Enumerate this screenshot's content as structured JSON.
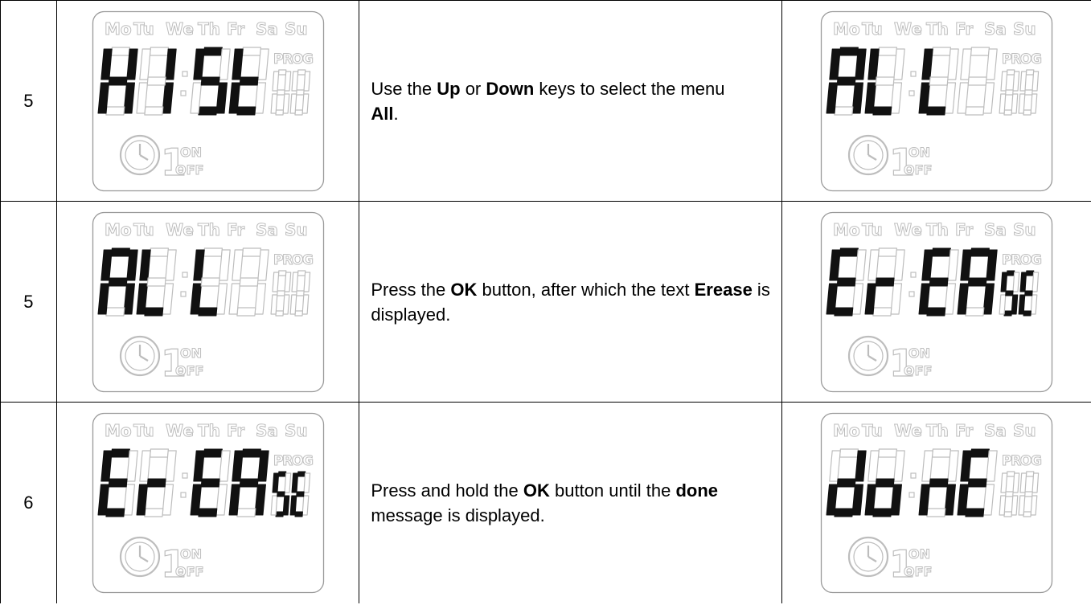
{
  "rows": [
    {
      "step": "5",
      "before": {
        "main": [
          "H",
          "I",
          "5",
          "t"
        ],
        "small": [
          "",
          ""
        ]
      },
      "text": [
        {
          "t": "Use the ",
          "b": false
        },
        {
          "t": "Up",
          "b": true
        },
        {
          "t": " or ",
          "b": false
        },
        {
          "t": "Down",
          "b": true
        },
        {
          "t": " keys to select the menu",
          "b": false
        },
        {
          "t": "\n",
          "b": false
        },
        {
          "t": "All",
          "b": true
        },
        {
          "t": ".",
          "b": false
        }
      ],
      "after": {
        "main": [
          "A",
          "L",
          "L",
          ""
        ],
        "small": [
          "",
          ""
        ]
      }
    },
    {
      "step": "5",
      "before": {
        "main": [
          "A",
          "L",
          "L",
          ""
        ],
        "small": [
          "",
          ""
        ]
      },
      "text": [
        {
          "t": "Press the ",
          "b": false
        },
        {
          "t": "OK",
          "b": true
        },
        {
          "t": " button, after which the text ",
          "b": false
        },
        {
          "t": "Erease",
          "b": true
        },
        {
          "t": " is displayed.",
          "b": false
        }
      ],
      "after": {
        "main": [
          "E",
          "r",
          "E",
          "A"
        ],
        "small": [
          "S",
          "E"
        ]
      }
    },
    {
      "step": "6",
      "before": {
        "main": [
          "E",
          "r",
          "E",
          "A"
        ],
        "small": [
          "S",
          "E"
        ]
      },
      "text": [
        {
          "t": "Press and hold the ",
          "b": false
        },
        {
          "t": "OK",
          "b": true
        },
        {
          "t": " button until the ",
          "b": false
        },
        {
          "t": "done",
          "b": true
        },
        {
          "t": " message is displayed.",
          "b": false
        }
      ],
      "after": {
        "main": [
          "d",
          "o",
          "n",
          "E"
        ],
        "small": [
          "",
          ""
        ]
      }
    }
  ],
  "lcd": {
    "days": [
      "Mo",
      "Tu",
      "We",
      "Th",
      "Fr",
      "Sa",
      "Su"
    ],
    "prog_label": "PROG",
    "on_label": "ON",
    "off_label": "OFF",
    "timer_digit": "1",
    "colors": {
      "active": "#111111",
      "inactive": "#dcdcdc",
      "outline": "#bdbdbd"
    }
  }
}
